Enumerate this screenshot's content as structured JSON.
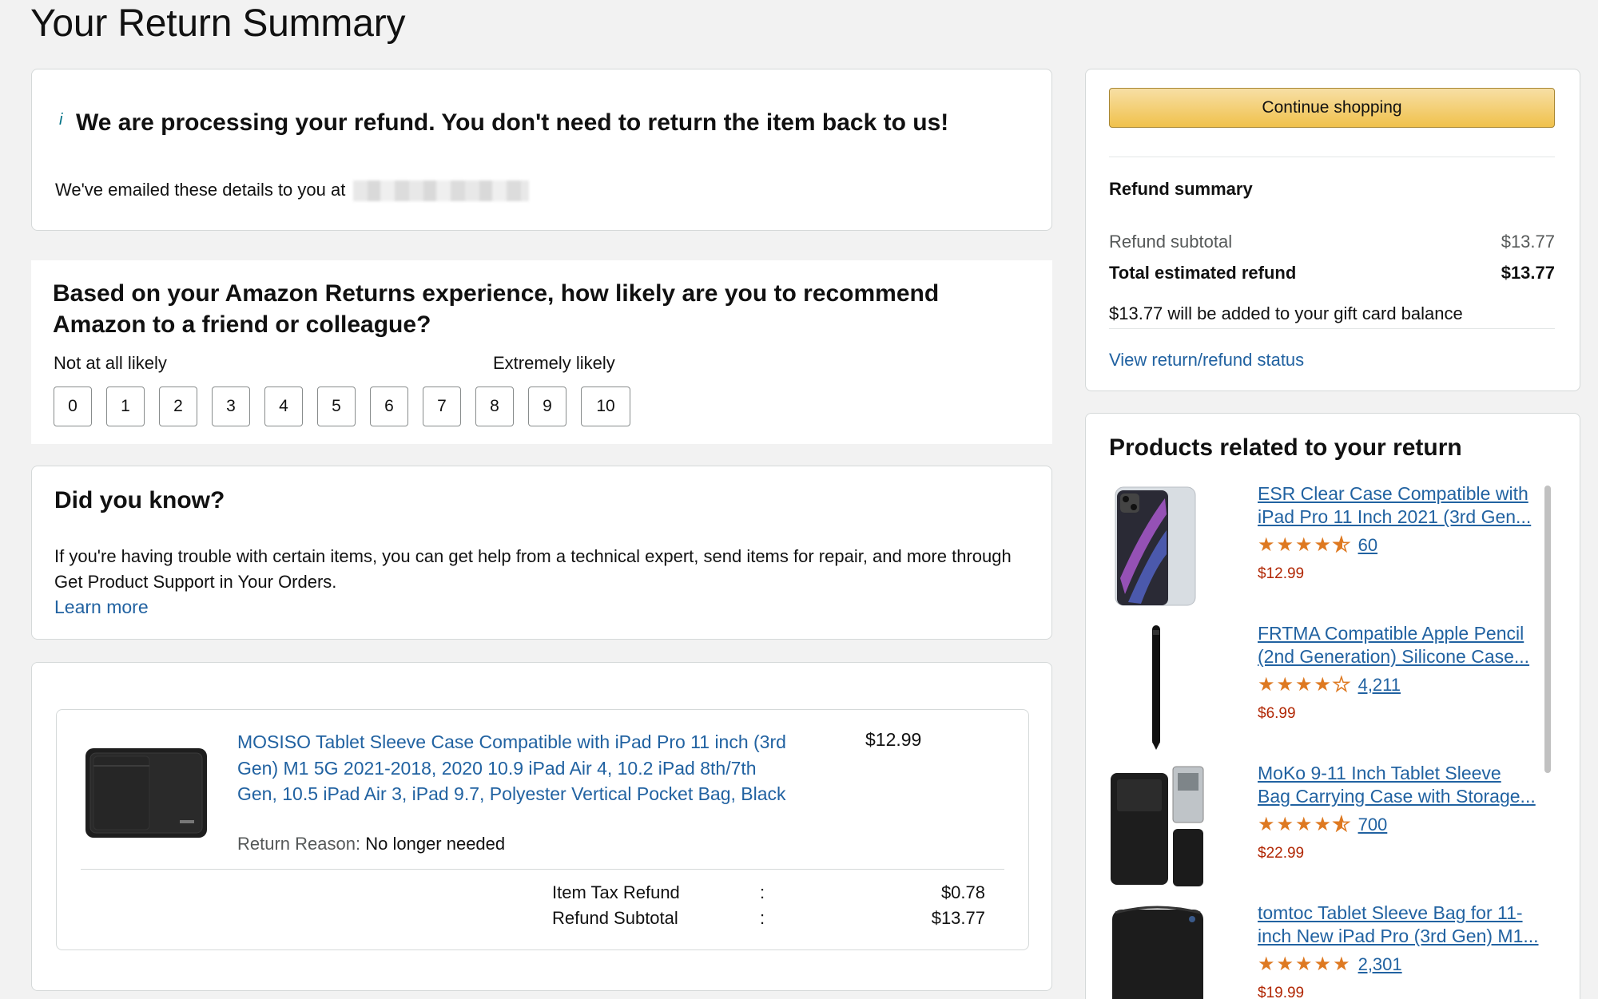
{
  "page": {
    "title": "Your Return Summary"
  },
  "processing": {
    "info_mark": "i",
    "heading": "We are processing your refund. You don't need to return the item back to us!",
    "email_prefix": "We've emailed these details to you at"
  },
  "survey": {
    "question": "Based on your Amazon Returns experience, how likely are you to recommend Amazon to a friend or colleague?",
    "low_label": "Not at all likely",
    "high_label": "Extremely likely",
    "scores": [
      "0",
      "1",
      "2",
      "3",
      "4",
      "5",
      "6",
      "7",
      "8",
      "9",
      "10"
    ]
  },
  "did_you_know": {
    "title": "Did you know?",
    "text": "If you're having trouble with certain items, you can get help from a technical expert, send items for repair, and more through Get Product Support in Your Orders.",
    "link": "Learn more"
  },
  "item": {
    "title": "MOSISO Tablet Sleeve Case Compatible with iPad Pro 11 inch (3rd Gen) M1 5G 2021-2018, 2020 10.9 iPad Air 4, 10.2 iPad 8th/7th Gen, 10.5 iPad Air 3, iPad 9.7, Polyester Vertical Pocket Bag, Black",
    "price": "$12.99",
    "return_reason_label": "Return Reason:",
    "return_reason": "No longer needed",
    "tax_label": "Item Tax Refund",
    "tax_value": "$0.78",
    "subtotal_label": "Refund Subtotal",
    "subtotal_value": "$13.77",
    "colon": ":"
  },
  "refund": {
    "continue_button": "Continue shopping",
    "title": "Refund summary",
    "subtotal_label": "Refund subtotal",
    "subtotal_value": "$13.77",
    "total_label": "Total estimated refund",
    "total_value": "$13.77",
    "gift_note": "$13.77 will be added to your gift card balance",
    "status_link": "View return/refund status"
  },
  "related": {
    "title": "Products related to your return",
    "products": [
      {
        "title": "ESR Clear Case Compatible with iPad Pro 11 Inch 2021 (3rd Gen...",
        "rating": 4.5,
        "count": "60",
        "price": "$12.99",
        "icon": "tablet-case-image"
      },
      {
        "title": "FRTMA Compatible Apple Pencil (2nd Generation) Silicone Case...",
        "rating": 4.0,
        "count": "4,211",
        "price": "$6.99",
        "icon": "pencil-case-image"
      },
      {
        "title": "MoKo 9-11 Inch Tablet Sleeve Bag Carrying Case with Storage...",
        "rating": 4.5,
        "count": "700",
        "price": "$22.99",
        "icon": "tablet-sleeve-image"
      },
      {
        "title": "tomtoc Tablet Sleeve Bag for 11-inch New iPad Pro (3rd Gen) M1...",
        "rating": 5.0,
        "count": "2,301",
        "price": "$19.99",
        "icon": "tablet-bag-image"
      }
    ]
  },
  "colors": {
    "link": "#2162a1",
    "price_red": "#b12704",
    "star": "#de7921",
    "button_yellow": "#f0c14b"
  }
}
